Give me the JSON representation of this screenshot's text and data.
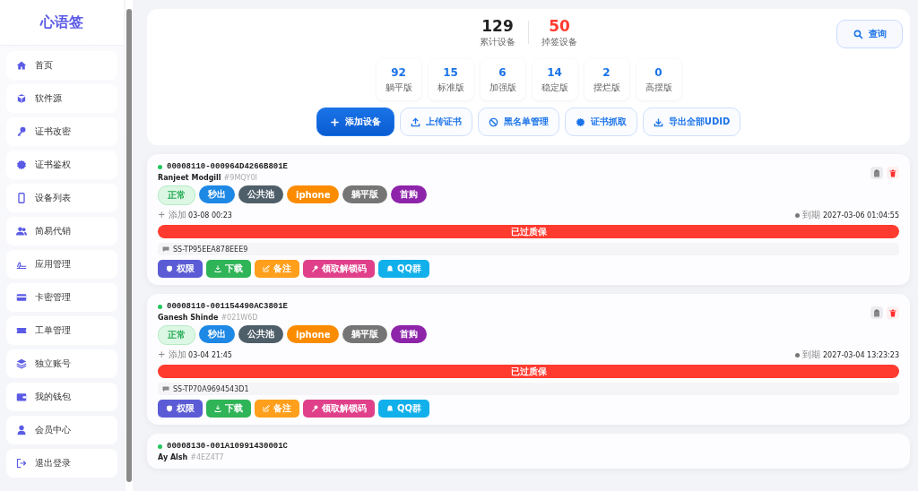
{
  "sidebar": {
    "logo": "心语签",
    "items": [
      {
        "label": "首页",
        "selected": false
      },
      {
        "label": "软件源",
        "selected": false
      },
      {
        "label": "证书改密",
        "selected": false
      },
      {
        "label": "证书鉴权",
        "selected": false
      },
      {
        "label": "设备列表",
        "selected": false
      },
      {
        "label": "简易代销",
        "selected": false
      },
      {
        "label": "应用管理",
        "selected": false
      },
      {
        "label": "卡密管理",
        "selected": false
      },
      {
        "label": "工单管理",
        "selected": false
      },
      {
        "label": "独立账号",
        "selected": false
      },
      {
        "label": "我的钱包",
        "selected": false
      },
      {
        "label": "会员中心",
        "selected": false
      },
      {
        "label": "退出登录",
        "selected": false
      }
    ]
  },
  "summary": [
    {
      "value": "129",
      "label": "累计设备",
      "color": "#222222"
    },
    {
      "value": "50",
      "label": "掉签设备",
      "color": "#ff3b30"
    }
  ],
  "query_button": "查询",
  "versions": [
    {
      "value": "92",
      "label": "躺平版"
    },
    {
      "value": "15",
      "label": "标准版"
    },
    {
      "value": "6",
      "label": "加强版"
    },
    {
      "value": "14",
      "label": "稳定版"
    },
    {
      "value": "2",
      "label": "摆烂版"
    },
    {
      "value": "0",
      "label": "高摆版"
    }
  ],
  "toolbar": [
    {
      "label": "添加设备",
      "kind": "primary"
    },
    {
      "label": "上传证书",
      "kind": "outline"
    },
    {
      "label": "黑名单管理",
      "kind": "outline"
    },
    {
      "label": "证书抓取",
      "kind": "outline"
    },
    {
      "label": "导出全部UDID",
      "kind": "outline"
    }
  ],
  "devices": [
    {
      "udid": "00008110-000964D4266B801E",
      "online": true,
      "owner": "Ranjeet Modgill",
      "code": "#9MQY0I",
      "tags": [
        {
          "text": "正常",
          "kind": "soft",
          "color": "#dcf7e4"
        },
        {
          "text": "秒出",
          "kind": "solid",
          "color": "#1e88e5"
        },
        {
          "text": "公共池",
          "kind": "solid",
          "color": "#4f5f6a"
        },
        {
          "text": "iphone",
          "kind": "solid",
          "color": "#fb8c00"
        },
        {
          "text": "躺平版",
          "kind": "solid",
          "color": "#757575"
        },
        {
          "text": "首购",
          "kind": "solid",
          "color": "#8e24aa"
        }
      ],
      "added_label": "+ 添加",
      "added": "03-08 00:23",
      "expiry_label": "到期",
      "expiry": "2027-03-06 01:04:55",
      "warranty": "已过质保",
      "note": "SS-TP95EEA878EEE9",
      "actions": [
        "权限",
        "下载",
        "备注",
        "领取解锁码",
        "QQ群"
      ]
    },
    {
      "udid": "00008110-001154490AC3801E",
      "online": true,
      "owner": "Ganesh Shinde",
      "code": "#021W6D",
      "tags": [
        {
          "text": "正常",
          "kind": "soft",
          "color": "#dcf7e4"
        },
        {
          "text": "秒出",
          "kind": "solid",
          "color": "#1e88e5"
        },
        {
          "text": "公共池",
          "kind": "solid",
          "color": "#4f5f6a"
        },
        {
          "text": "iphone",
          "kind": "solid",
          "color": "#fb8c00"
        },
        {
          "text": "躺平版",
          "kind": "solid",
          "color": "#757575"
        },
        {
          "text": "首购",
          "kind": "solid",
          "color": "#8e24aa"
        }
      ],
      "added_label": "+ 添加",
      "added": "03-04 21:45",
      "expiry_label": "到期",
      "expiry": "2027-03-04 13:23:23",
      "warranty": "已过质保",
      "note": "SS-TP70A9694543D1",
      "actions": [
        "权限",
        "下载",
        "备注",
        "领取解锁码",
        "QQ群"
      ]
    },
    {
      "udid": "00008130-001A10991430001C",
      "online": true,
      "owner": "Ay Alsh",
      "code": "#4EZ4T7"
    }
  ]
}
